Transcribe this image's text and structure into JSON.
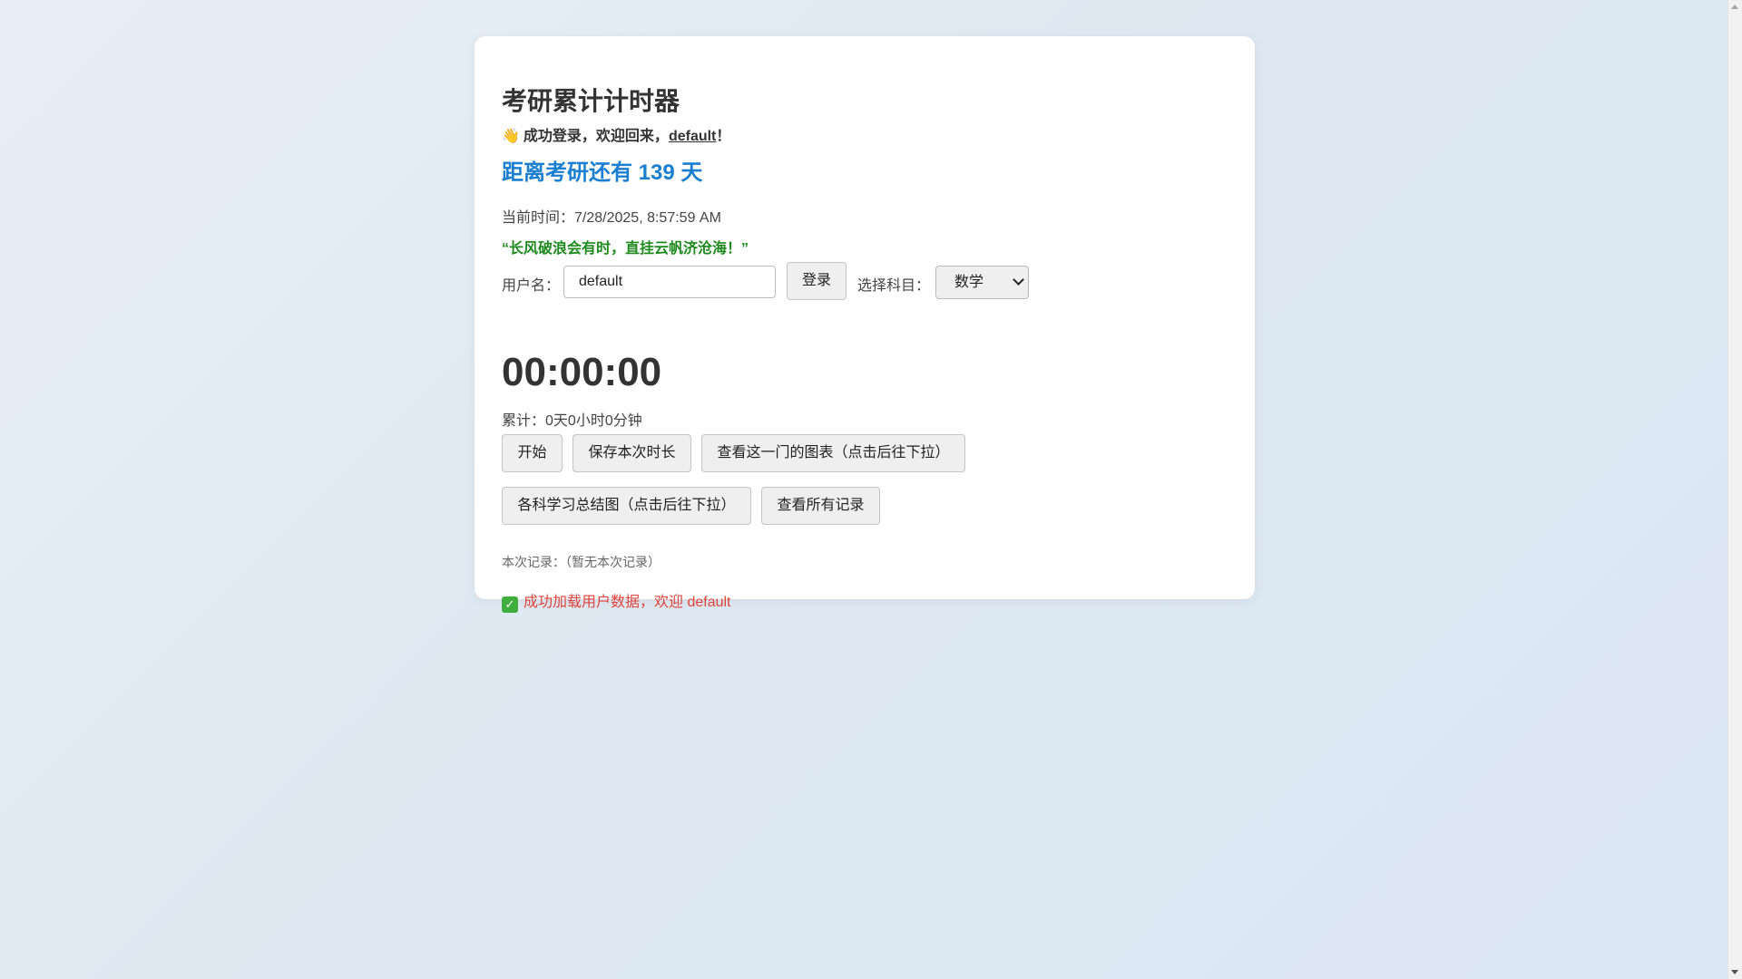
{
  "app": {
    "title": "考研累计计时器"
  },
  "welcome": {
    "icon": "waving-hand-icon",
    "prefix": "成功登录，欢迎回来，",
    "username": "default",
    "suffix": "！"
  },
  "countdown": {
    "text": "距离考研还有 139 天"
  },
  "clock": {
    "label": "当前时间：",
    "value": "7/28/2025, 8:57:59 AM"
  },
  "quote": {
    "text": "“长风破浪会有时，直挂云帆济沧海！”"
  },
  "login": {
    "username_label": "用户名：",
    "username_value": "default",
    "login_button": "登录",
    "subject_label": "选择科目：",
    "subject_selected": "数学"
  },
  "timer": {
    "display": "00:00:00",
    "total_label": "累计：",
    "total_value": "0天0小时0分钟"
  },
  "actions": {
    "start": "开始",
    "save": "保存本次时长",
    "subject_chart": "查看这一门的图表（点击后往下拉）",
    "summary_chart": "各科学习总结图（点击后往下拉）",
    "all_records": "查看所有记录"
  },
  "session": {
    "record_text": "本次记录：（暂无本次记录）"
  },
  "status": {
    "icon": "check-mark-icon",
    "message": "成功加载用户数据，欢迎 default"
  },
  "colors": {
    "accent_blue": "#1a7fd1",
    "quote_green": "#1e8a1e",
    "status_red": "#e0433a"
  }
}
